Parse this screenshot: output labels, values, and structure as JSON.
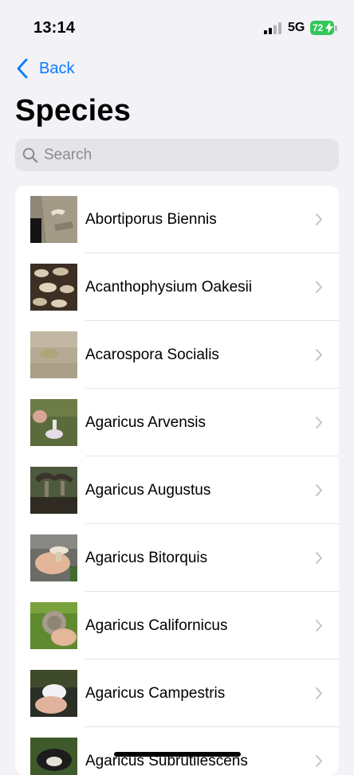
{
  "status_bar": {
    "time": "13:14",
    "network": "5G",
    "battery_level": "72",
    "battery_color": "#34c759",
    "signal_icon": "cellular-signal-icon"
  },
  "nav": {
    "back_label": "Back",
    "back_icon": "chevron-left-icon",
    "title": "Species"
  },
  "search": {
    "placeholder": "Search",
    "value": "",
    "icon": "magnifying-glass-icon"
  },
  "species": [
    {
      "name": "Abortiporus Biennis"
    },
    {
      "name": "Acanthophysium Oakesii"
    },
    {
      "name": "Acarospora Socialis"
    },
    {
      "name": "Agaricus Arvensis"
    },
    {
      "name": "Agaricus Augustus"
    },
    {
      "name": "Agaricus Bitorquis"
    },
    {
      "name": "Agaricus Californicus"
    },
    {
      "name": "Agaricus Campestris"
    },
    {
      "name": "Agaricus Subrutilescens"
    }
  ],
  "colors": {
    "accent": "#0a7cff",
    "background": "#f2f2f7",
    "row_background": "#ffffff",
    "chevron": "#c4c4c7"
  }
}
